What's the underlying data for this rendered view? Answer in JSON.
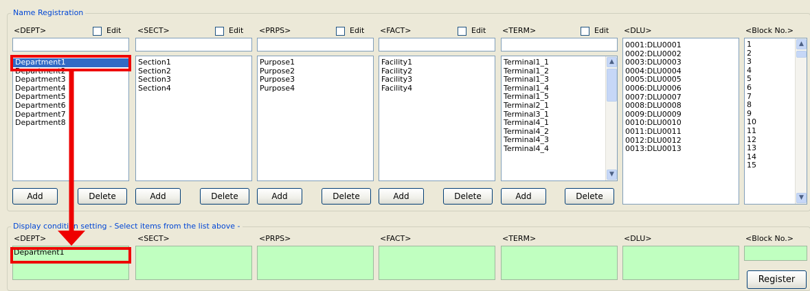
{
  "registration": {
    "legend": "Name Registration",
    "edit_label": "Edit",
    "add_label": "Add",
    "delete_label": "Delete",
    "columns": {
      "dept": {
        "header": "<DEPT>",
        "items": [
          "Department1",
          "Department2",
          "Department3",
          "Department4",
          "Department5",
          "Department6",
          "Department7",
          "Department8"
        ],
        "selected": "Department1"
      },
      "sect": {
        "header": "<SECT>",
        "items": [
          "Section1",
          "Section2",
          "Section3",
          "Section4"
        ]
      },
      "prps": {
        "header": "<PRPS>",
        "items": [
          "Purpose1",
          "Purpose2",
          "Purpose3",
          "Purpose4"
        ]
      },
      "fact": {
        "header": "<FACT>",
        "items": [
          "Facility1",
          "Facility2",
          "Facility3",
          "Facility4"
        ]
      },
      "term": {
        "header": "<TERM>",
        "items": [
          "Terminal1_1",
          "Terminal1_2",
          "Terminal1_3",
          "Terminal1_4",
          "Terminal1_5",
          "Terminal2_1",
          "Terminal3_1",
          "Terminal4_1",
          "Terminal4_2",
          "Terminal4_3",
          "Terminal4_4"
        ]
      },
      "dlu": {
        "header": "<DLU>",
        "items": [
          "0001:DLU0001",
          "0002:DLU0002",
          "0003:DLU0003",
          "0004:DLU0004",
          "0005:DLU0005",
          "0006:DLU0006",
          "0007:DLU0007",
          "0008:DLU0008",
          "0009:DLU0009",
          "0010:DLU0010",
          "0011:DLU0011",
          "0012:DLU0012",
          "0013:DLU0013"
        ]
      },
      "block": {
        "header": "<Block No.>",
        "items": [
          "1",
          "2",
          "3",
          "4",
          "5",
          "6",
          "7",
          "8",
          "9",
          "10",
          "11",
          "12",
          "13",
          "14",
          "15"
        ]
      }
    }
  },
  "display": {
    "legend": "Display condition setting - Select items from the list above -",
    "headers": {
      "dept": "<DEPT>",
      "sect": "<SECT>",
      "prps": "<PRPS>",
      "fact": "<FACT>",
      "term": "<TERM>",
      "dlu": "<DLU>",
      "block": "<Block No.>"
    },
    "dept_value": "Department1",
    "register_label": "Register"
  },
  "annotation": {
    "highlight_color": "#ee0000"
  },
  "icons": {
    "scroll_up": "chevron-up-icon",
    "scroll_down": "chevron-down-icon"
  }
}
